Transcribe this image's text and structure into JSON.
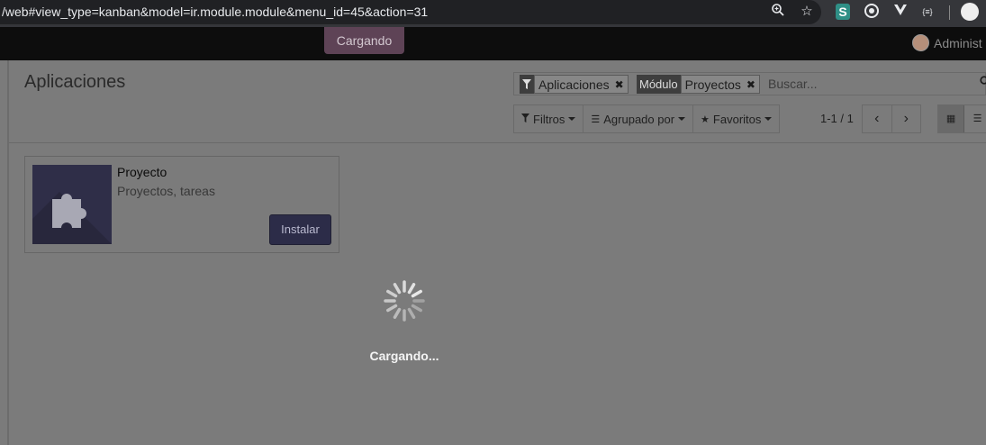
{
  "browser": {
    "url": "/web#view_type=kanban&model=ir.module.module&menu_id=45&action=31",
    "icons": [
      "zoom-icon",
      "bookmark-star-icon",
      "extension-s-icon",
      "extension-target-icon",
      "extension-vuejs-icon",
      "extension-json-icon",
      "profile-icon"
    ],
    "ext_s_label": "S",
    "ext_json_label": "{≡}"
  },
  "navbar": {
    "loading_label": "Cargando",
    "user_name": "Administ"
  },
  "control_panel": {
    "title": "Aplicaciones",
    "facets": [
      {
        "label_icon": "filter-icon",
        "value": "Aplicaciones"
      },
      {
        "label": "Módulo",
        "value": "Proyectos"
      }
    ],
    "search_placeholder": "Buscar...",
    "buttons": {
      "filters": "Filtros",
      "group_by": "Agrupado por",
      "favorites": "Favoritos"
    },
    "pager": "1-1 / 1"
  },
  "kanban": {
    "cards": [
      {
        "title": "Proyecto",
        "summary": "Proyectos, tareas",
        "button": "Instalar",
        "icon": "puzzle-icon"
      }
    ]
  },
  "loading": {
    "text": "Cargando..."
  },
  "colors": {
    "overlay": "#7b7b7b",
    "navbar": "#0d0d0d",
    "loading_pill": "#5e4356",
    "install_button": "#2c2c48"
  }
}
